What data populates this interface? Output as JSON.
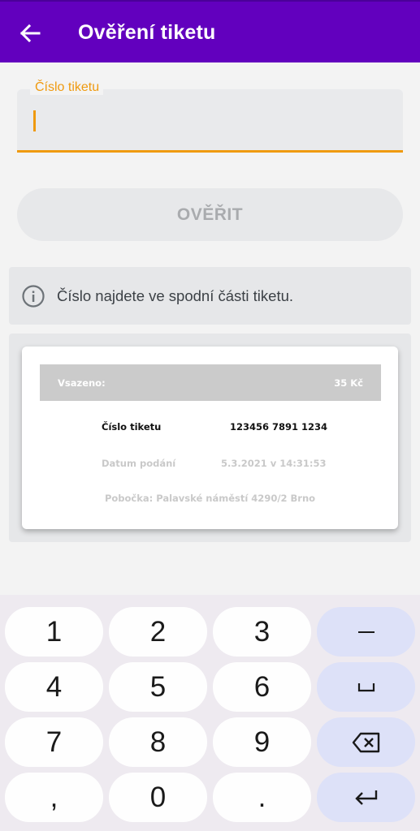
{
  "appbar": {
    "title": "Ověření tiketu",
    "back_icon": "arrow-left-icon"
  },
  "form": {
    "field_label": "Číslo tiketu",
    "field_value": "",
    "verify_label": "OVĚŘIT"
  },
  "info": {
    "icon": "info-circle-icon",
    "text": "Číslo najdete ve spodní části tiketu."
  },
  "ticket": {
    "bet_label": "Vsazeno:",
    "bet_value": "35 Kč",
    "number_label": "Číslo tiketu",
    "number_value": "123456 7891 1234",
    "date_label": "Datum podání",
    "date_value": "5.3.2021 v 14:31:53",
    "branch": "Pobočka: Palavské náměstí 4290/2 Brno"
  },
  "keyboard": {
    "keys": [
      "1",
      "2",
      "3",
      "−",
      "4",
      "5",
      "6",
      "␣",
      "7",
      "8",
      "9",
      "⌫",
      ",",
      "0",
      ".",
      "↵"
    ]
  },
  "colors": {
    "appbar": "#6200be",
    "accent": "#ef9a10"
  }
}
